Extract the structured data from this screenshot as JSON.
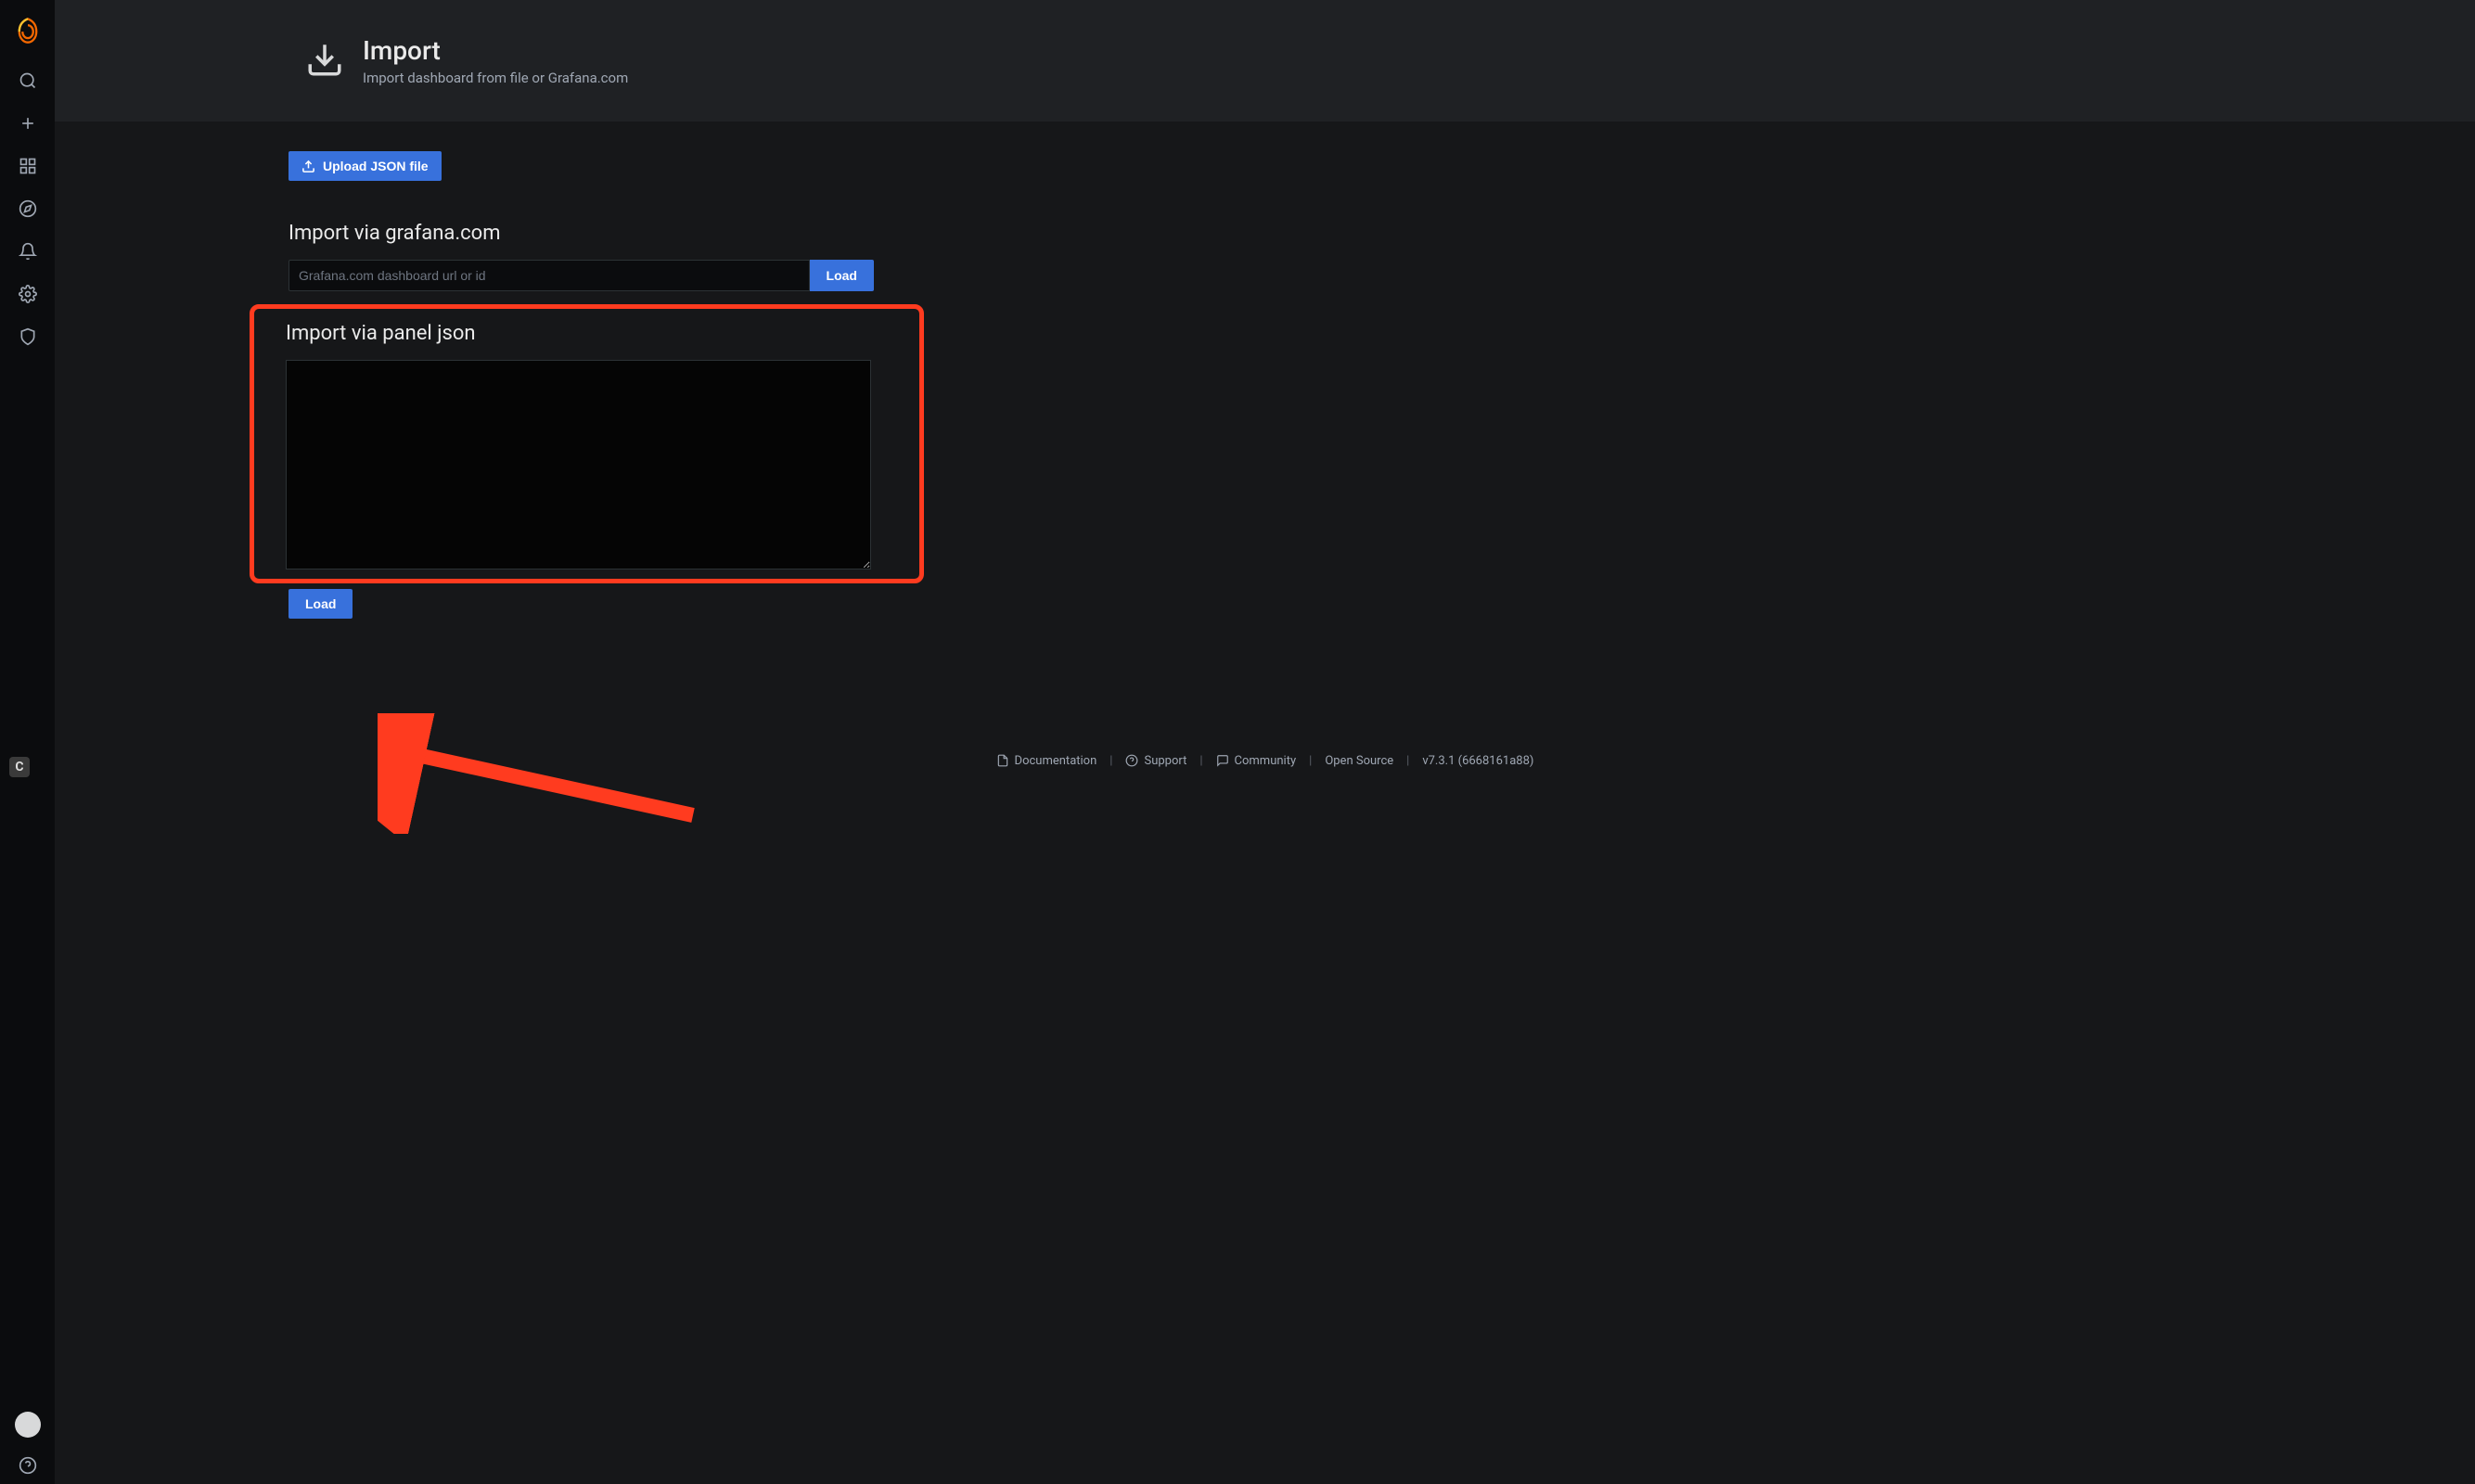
{
  "header": {
    "title": "Import",
    "subtitle": "Import dashboard from file or Grafana.com"
  },
  "actions": {
    "upload_json_label": "Upload JSON file"
  },
  "import_url": {
    "heading": "Import via grafana.com",
    "placeholder": "Grafana.com dashboard url or id",
    "load_label": "Load"
  },
  "import_json": {
    "heading": "Import via panel json",
    "textarea_value": "",
    "load_label": "Load"
  },
  "footer": {
    "documentation": "Documentation",
    "support": "Support",
    "community": "Community",
    "license": "Open Source",
    "version": "v7.3.1 (6668161a88)"
  }
}
